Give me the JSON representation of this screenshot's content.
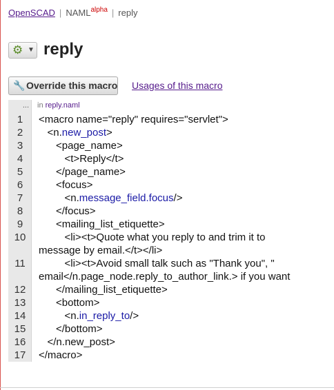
{
  "breadcrumb": {
    "root": "OpenSCAD",
    "naml": "NAML",
    "naml_badge": "alpha",
    "current": "reply"
  },
  "header": {
    "title": "reply",
    "gear_icon": "gear-icon"
  },
  "actions": {
    "override_label": "Override this macro",
    "usages_label": "Usages of this macro"
  },
  "code": {
    "header_dots": "...",
    "header_in": "in",
    "file": "reply.naml",
    "lines": [
      {
        "n": "1",
        "text": "<macro name=\"reply\" requires=\"servlet\">"
      },
      {
        "n": "2",
        "pre": "   <n.",
        "blue": "new_post",
        "post": ">"
      },
      {
        "n": "3",
        "text": "      <page_name>"
      },
      {
        "n": "4",
        "text": "         <t>Reply</t>"
      },
      {
        "n": "5",
        "text": "      </page_name>"
      },
      {
        "n": "6",
        "text": "      <focus>"
      },
      {
        "n": "7",
        "pre": "         <n.",
        "blue": "message_field.focus",
        "post": "/>"
      },
      {
        "n": "8",
        "text": "      </focus>"
      },
      {
        "n": "9",
        "text": "      <mailing_list_etiquette>"
      },
      {
        "n": "10",
        "text": "         <li><t>Quote what you reply to and trim it to",
        "wrap": "message by email.</t></li>"
      },
      {
        "n": "11",
        "text": "         <li><t>Avoid small talk such as \"Thank you\", \"",
        "wrap": "email</n.page_node.reply_to_author_link.> if you want"
      },
      {
        "n": "12",
        "text": "      </mailing_list_etiquette>"
      },
      {
        "n": "13",
        "text": "      <bottom>"
      },
      {
        "n": "14",
        "pre": "         <n.",
        "blue": "in_reply_to",
        "post": "/>"
      },
      {
        "n": "15",
        "text": "      </bottom>"
      },
      {
        "n": "16",
        "text": "   </n.new_post>"
      },
      {
        "n": "17",
        "text": "</macro>"
      }
    ]
  }
}
